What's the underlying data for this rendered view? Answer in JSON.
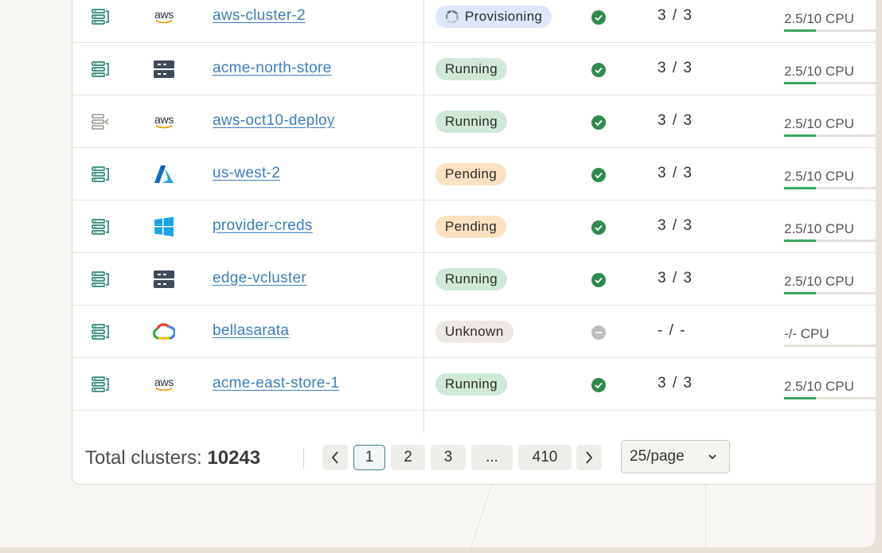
{
  "clusters": [
    {
      "type_icon": "cluster-icon",
      "provider_icon": "aws-logo-icon",
      "provider_text": "aws",
      "name": "aws-cluster-2",
      "status": "Provisioning",
      "status_kind": "provisioning",
      "health": "healthy",
      "nodes": "3 / 3",
      "cpu": "2.5/10 CPU",
      "cpu_fraction": 0.25
    },
    {
      "type_icon": "cluster-icon",
      "provider_icon": "server-rack-icon",
      "name": "acme-north-store",
      "status": "Running",
      "status_kind": "running",
      "health": "healthy",
      "nodes": "3 / 3",
      "cpu": "2.5/10 CPU",
      "cpu_fraction": 0.25
    },
    {
      "type_icon": "cluster-imported-icon",
      "provider_icon": "aws-logo-icon",
      "provider_text": "aws",
      "name": "aws-oct10-deploy",
      "status": "Running",
      "status_kind": "running",
      "health": "healthy",
      "nodes": "3 / 3",
      "cpu": "2.5/10 CPU",
      "cpu_fraction": 0.25
    },
    {
      "type_icon": "cluster-icon",
      "provider_icon": "azure-logo-icon",
      "name": "us-west-2",
      "status": "Pending",
      "status_kind": "pending",
      "health": "healthy",
      "nodes": "3 / 3",
      "cpu": "2.5/10 CPU",
      "cpu_fraction": 0.25
    },
    {
      "type_icon": "cluster-icon",
      "provider_icon": "windows-logo-icon",
      "name": "provider-creds",
      "status": "Pending",
      "status_kind": "pending",
      "health": "healthy",
      "nodes": "3 / 3",
      "cpu": "2.5/10 CPU",
      "cpu_fraction": 0.25
    },
    {
      "type_icon": "cluster-icon",
      "provider_icon": "server-rack-icon",
      "name": "edge-vcluster",
      "status": "Running",
      "status_kind": "running",
      "health": "healthy",
      "nodes": "3 / 3",
      "cpu": "2.5/10 CPU",
      "cpu_fraction": 0.25
    },
    {
      "type_icon": "cluster-icon",
      "provider_icon": "google-cloud-logo-icon",
      "name": "bellasarata",
      "status": "Unknown",
      "status_kind": "unknown",
      "health": "unknown",
      "nodes": "- / -",
      "cpu": "-/- CPU",
      "cpu_fraction": 0
    },
    {
      "type_icon": "cluster-icon",
      "provider_icon": "aws-logo-icon",
      "provider_text": "aws",
      "name": "acme-east-store-1",
      "status": "Running",
      "status_kind": "running",
      "health": "healthy",
      "nodes": "3 / 3",
      "cpu": "2.5/10 CPU",
      "cpu_fraction": 0.25
    }
  ],
  "footer": {
    "total_label": "Total clusters:",
    "total_value": "10243",
    "pages": [
      "1",
      "2",
      "3",
      "...",
      "410"
    ],
    "active_page": "1",
    "page_size": "25/page"
  },
  "colors": {
    "link": "#3c7dbf",
    "healthy": "#2f8a4e",
    "cpu_fill": "#3aa55e",
    "running_bg": "#cfe9d6",
    "pending_bg": "#fbe0c2",
    "unknown_bg": "#ece8e3",
    "provisioning_bg": "#dde6fa"
  }
}
